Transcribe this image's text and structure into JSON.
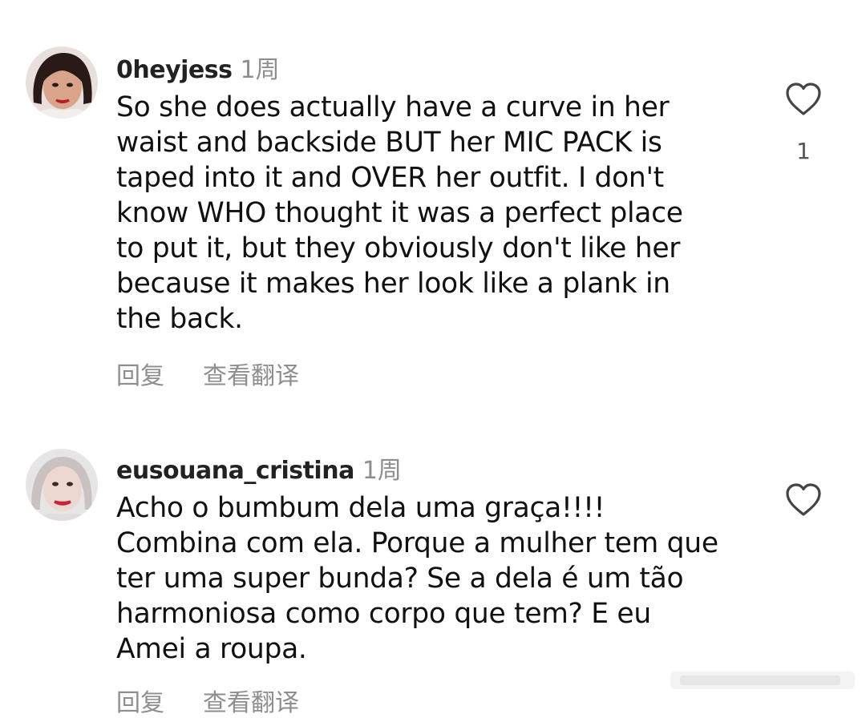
{
  "comments": [
    {
      "username": "0heyjess",
      "time": "1周",
      "lines": [
        "So she does actually have a curve in her",
        "waist and backside BUT her MIC PACK is",
        "taped into it and OVER her outfit. I don't",
        "know WHO thought it was a perfect place",
        "to put it, but they obviously don't like her",
        "because it makes her look like a plank in",
        "the back."
      ],
      "reply_label": "回复",
      "translate_label": "查看翻译",
      "like_count": "1",
      "like_icon": "heart-outline-icon"
    },
    {
      "username": "eusouana_cristina",
      "time": "1周",
      "lines": [
        "Acho o bumbum dela uma graça!!!!",
        "Combina com ela. Porque a mulher tem que",
        "ter uma super bunda? Se a dela é um tão",
        "harmoniosa como corpo que tem? E eu",
        "Amei a roupa."
      ],
      "reply_label": "回复",
      "translate_label": "查看翻译",
      "like_icon": "heart-outline-icon"
    }
  ],
  "colors": {
    "text": "#111111",
    "muted": "#8e8e8e",
    "background": "#ffffff"
  }
}
